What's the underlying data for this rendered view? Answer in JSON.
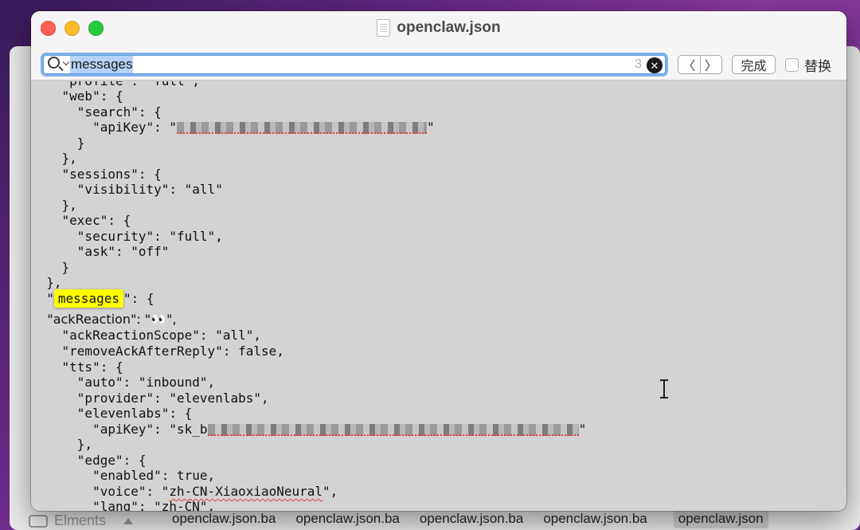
{
  "window": {
    "title": "openclaw.json"
  },
  "find_bar": {
    "query": "messages",
    "match_count": "3",
    "clear_symbol": "✕",
    "prev_symbol": "〈",
    "next_symbol": "〉",
    "done_label": "完成",
    "replace_label": "替换",
    "replace_checked": false
  },
  "editor": {
    "lines": [
      "    \"profile\": \"full\",",
      "    \"web\": {",
      "      \"search\": {",
      "        \"apiKey\": \"",
      "      }",
      "    },",
      "    \"sessions\": {",
      "      \"visibility\": \"all\"",
      "    },",
      "    \"exec\": {",
      "      \"security\": \"full\",",
      "      \"ask\": \"off\"",
      "    }",
      "  },",
      "  \"",
      "    \"ackReaction\": \"👀\",",
      "    \"ackReactionScope\": \"all\",",
      "    \"removeAckAfterReply\": false,",
      "    \"tts\": {",
      "      \"auto\": \"inbound\",",
      "      \"provider\": \"elevenlabs\",",
      "      \"elevenlabs\": {",
      "        \"apiKey\": \"sk_b",
      "      },",
      "      \"edge\": {",
      "        \"enabled\": true,",
      "        \"voice\": \"",
      "        \"lang\": \"zh-CN\","
    ],
    "highlight_word": "messages",
    "messages_suffix": "\": {",
    "search_key_suffix": "\"",
    "eleven_key_suffix": "\"",
    "voice_value": "zh-CN-XiaoxiaoNeural",
    "voice_suffix": "\","
  },
  "background_finder": {
    "sidebar_item": "Elments",
    "files": [
      "openclaw.json.ba",
      "openclaw.json.ba",
      "openclaw.json.ba",
      "openclaw.json.ba",
      "openclaw.json"
    ],
    "selected_index": 4
  },
  "colors": {
    "highlight": "#ffff00",
    "search_focus": "#7fb1ea",
    "editor_bg": "#d3d3d3"
  }
}
